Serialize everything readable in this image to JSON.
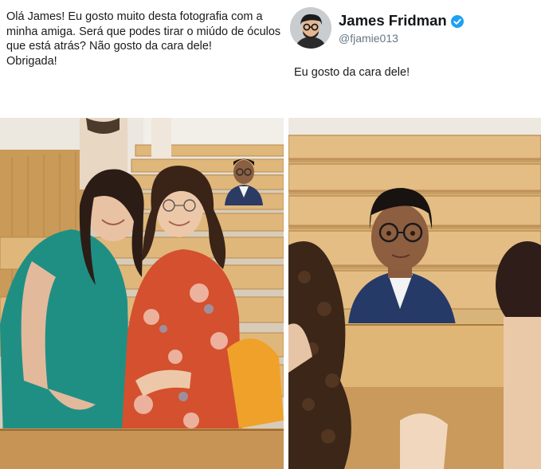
{
  "request": {
    "line1": "Olá James! Eu gosto muito desta fotografia com a",
    "line2": "minha amiga. Será que podes tirar o miúdo de óculos",
    "line3": "que está atrás? Não gosto da cara dele!",
    "line4": "Obrigada!"
  },
  "profile": {
    "name": "James Fridman",
    "handle": "@fjamie013",
    "verified_color": "#1da1f2"
  },
  "reply": {
    "text": "Eu gosto da cara dele!"
  },
  "icons": {
    "verified": "verified-badge-icon",
    "avatar": "avatar-icon"
  }
}
